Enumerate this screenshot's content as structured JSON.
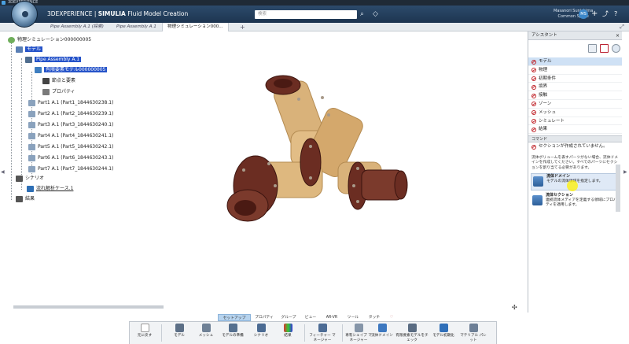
{
  "window": {
    "title": "3DEXPERIENCE"
  },
  "topbar": {
    "brand_prefix": "3DEXPERIENCE | ",
    "brand_app": "SIMULIA",
    "brand_suffix": " Fluid Model Creation",
    "search_placeholder": "検索",
    "user_name": "Masanori Sunishima",
    "user_space": "Common Space",
    "avatar_initials": "MS"
  },
  "tabs": [
    {
      "label": "Pipe Assembly A.1 (探索)"
    },
    {
      "label": "Pipe Assembly A.1"
    },
    {
      "label": "物理シミュレーション000..."
    }
  ],
  "tree": {
    "root": "物理シミュレーション000000005",
    "model": "モデル",
    "assembly": "Pipe Assembly A.1",
    "fem": "有限要素モデル000000005",
    "nodes": "節点と要素",
    "properties": "プロパティ",
    "parts": [
      "Part1 A.1 (Part1_1844630238.1)",
      "Part2 A.1 (Part2_1844630239.1)",
      "Part3 A.1 (Part3_1844630240.1)",
      "Part4 A.1 (Part4_1844630241.1)",
      "Part5 A.1 (Part5_1844630242.1)",
      "Part6 A.1 (Part6_1844630243.1)",
      "Part7 A.1 (Part7_1844630244.1)"
    ],
    "scenario": "シナリオ",
    "flow_case": "流れ解析ケース.1",
    "results": "結果"
  },
  "assistant": {
    "title": "アシスタント",
    "items": [
      "モデル",
      "物理",
      "初期条件",
      "境界",
      "接触",
      "ゾーン",
      "メッシュ",
      "シミュレート",
      "結果"
    ],
    "command_header": "コマンド",
    "status": "セクションが作成されていません。",
    "hint": "流体ボリュームを表すパーツがない場合、流体ドメインを作成してください。すべてのパーツにセクションを割り当てる必要があります。",
    "cmd_domain_title": "流体ドメイン",
    "cmd_domain_desc": "モデルの流体領域を指定します。",
    "cmd_section_title": "流体セクション",
    "cmd_section_desc": "連続流体メディアを定義する領域にプロパティを適用します。"
  },
  "action_tabs": [
    "セットアップ",
    "プロパティ",
    "グループ",
    "ビュー",
    "AR-VR",
    "ツール",
    "タッチ"
  ],
  "actions": [
    {
      "label": "元に戻す"
    },
    {
      "label": "モデル"
    },
    {
      "label": "メッシュ"
    },
    {
      "label": "モデルの準備"
    },
    {
      "label": "シナリオ"
    },
    {
      "label": "結果"
    },
    {
      "label": "フィーチャー マネージャー"
    },
    {
      "label": "専有シェイプ マネージャー"
    },
    {
      "label": "流体ドメイン"
    },
    {
      "label": "有限要素モデルをチェック"
    },
    {
      "label": "モデル初期化"
    },
    {
      "label": "マテリアル パレット"
    }
  ],
  "colors": {
    "selection": "#2553c9",
    "pipe_body": "#d9b27a",
    "flange": "#6b2d22",
    "topbar": "#2c4a6b"
  }
}
